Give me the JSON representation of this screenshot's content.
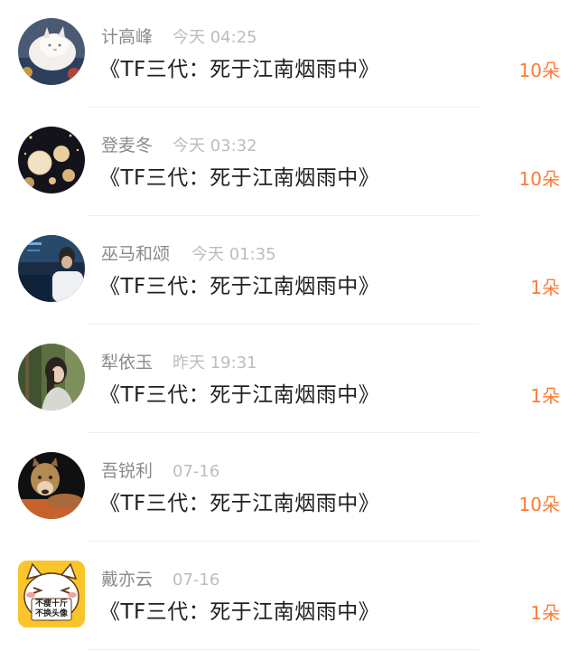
{
  "items": [
    {
      "name": "计高峰",
      "time": "今天 04:25",
      "title": "《TF三代：死于江南烟雨中》",
      "count": "10朵",
      "avatar": "white-kitten-avatar"
    },
    {
      "name": "登麦冬",
      "time": "今天 03:32",
      "title": "《TF三代：死于江南烟雨中》",
      "count": "10朵",
      "avatar": "lanterns-night-avatar"
    },
    {
      "name": "巫马和颂",
      "time": "今天 01:35",
      "title": "《TF三代：死于江南烟雨中》",
      "count": "1朵",
      "avatar": "night-person-avatar"
    },
    {
      "name": "犁依玉",
      "time": "昨天 19:31",
      "title": "《TF三代：死于江南烟雨中》",
      "count": "1朵",
      "avatar": "girl-forest-avatar"
    },
    {
      "name": "吾锐利",
      "time": "07-16",
      "title": "《TF三代：死于江南烟雨中》",
      "count": "10朵",
      "avatar": "cougar-avatar"
    },
    {
      "name": "戴亦云",
      "time": "07-16",
      "title": "《TF三代：死于江南烟雨中》",
      "count": "1朵",
      "avatar": "cartoon-cat-avatar",
      "avatar_text": [
        "不瘦十斤",
        "不换头像"
      ]
    }
  ],
  "colors": {
    "count": "#ff7a33",
    "name": "#8a8a8a",
    "time": "#bdbdbd",
    "title": "#1f1f1f"
  }
}
